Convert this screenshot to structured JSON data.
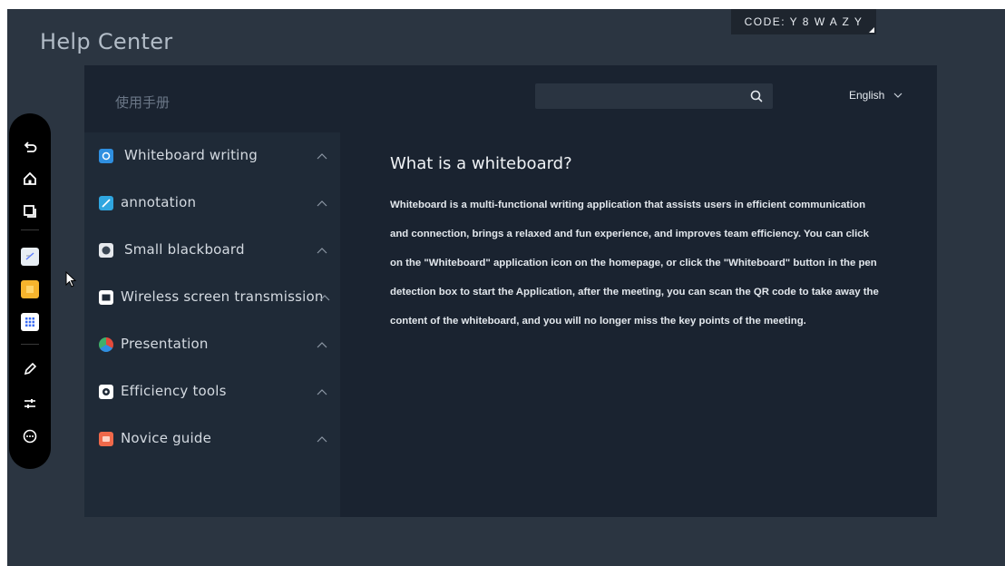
{
  "code_badge": "CODE: Y 8 W A Z Y",
  "page_title": "Help Center",
  "manual_title": "使用手册",
  "search": {
    "placeholder": ""
  },
  "language": "English",
  "sidebar": {
    "items": [
      {
        "label": "Whiteboard writing",
        "icon": "whiteboard-app-icon",
        "color": "#2f8fe0"
      },
      {
        "label": "annotation",
        "icon": "annotation-app-icon",
        "color": "#2fa6e0"
      },
      {
        "label": "Small blackboard",
        "icon": "blackboard-app-icon",
        "color": "#5d6a78"
      },
      {
        "label": "Wireless screen transmission",
        "icon": "screen-cast-icon",
        "color": "#ffffff"
      },
      {
        "label": "Presentation",
        "icon": "presentation-app-icon",
        "color": "#e24a3b"
      },
      {
        "label": "Efficiency tools",
        "icon": "tools-app-icon",
        "color": "#ffffff"
      },
      {
        "label": "Novice guide",
        "icon": "guide-app-icon",
        "color": "#f0694a"
      }
    ]
  },
  "content": {
    "title": "What is a whiteboard?",
    "body": "Whiteboard is a multi-functional writing application that assists users in efficient communication and connection, brings a relaxed and fun experience, and improves team efficiency. You can click on the \"Whiteboard\" application icon on the homepage, or click the \"Whiteboard\" button in the pen detection box to start the Application, after the meeting, you can scan the QR code to take away the content of the whiteboard, and you will no longer miss the key points of the meeting."
  },
  "dock": {
    "items": [
      "back-icon",
      "home-icon",
      "multitask-icon",
      "notes-app-icon",
      "sticky-notes-app-icon",
      "apps-grid-icon",
      "pen-icon",
      "settings-sliders-icon",
      "more-icon"
    ]
  },
  "colors": {
    "screen_bg": "#2b3541",
    "panel_bg": "#1a2330",
    "sidebar_bg": "#1f2a37",
    "dock_bg": "#000000"
  }
}
